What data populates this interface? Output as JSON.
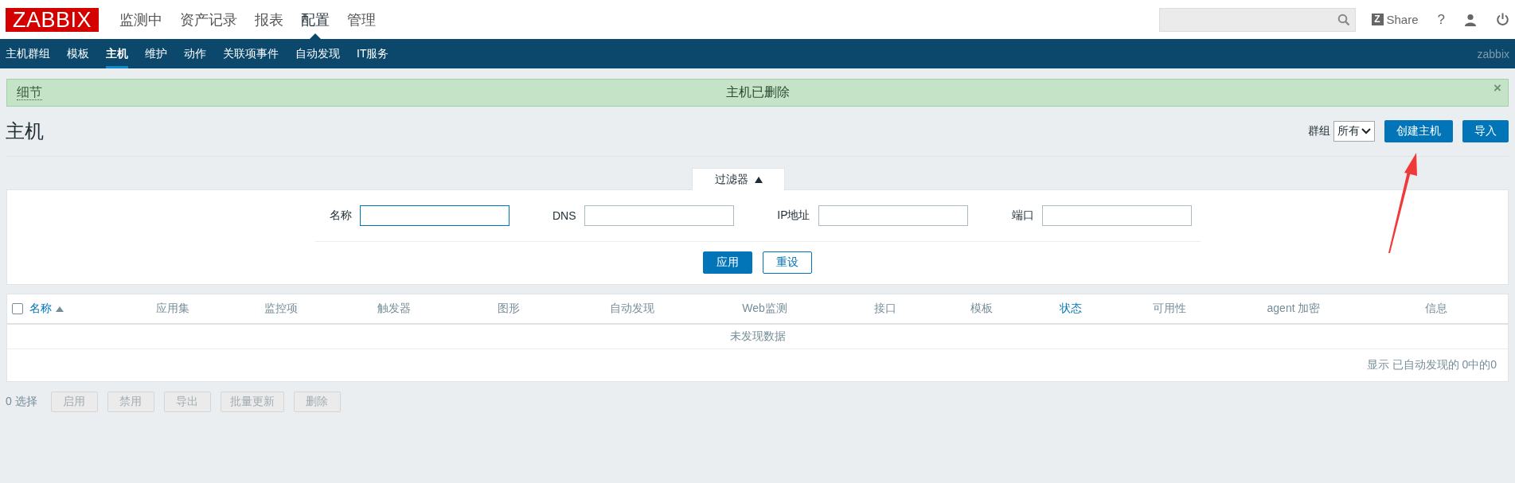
{
  "header": {
    "logo": "ZABBIX",
    "menu": [
      {
        "label": "监测中",
        "selected": false
      },
      {
        "label": "资产记录",
        "selected": false
      },
      {
        "label": "报表",
        "selected": false
      },
      {
        "label": "配置",
        "selected": true
      },
      {
        "label": "管理",
        "selected": false
      }
    ],
    "share": {
      "icon_text": "Z",
      "label": "Share"
    },
    "help": "?"
  },
  "subnav": {
    "items": [
      {
        "label": "主机群组",
        "selected": false
      },
      {
        "label": "模板",
        "selected": false
      },
      {
        "label": "主机",
        "selected": true
      },
      {
        "label": "维护",
        "selected": false
      },
      {
        "label": "动作",
        "selected": false
      },
      {
        "label": "关联项事件",
        "selected": false
      },
      {
        "label": "自动发现",
        "selected": false
      },
      {
        "label": "IT服务",
        "selected": false
      }
    ],
    "user": "zabbix"
  },
  "message": {
    "details_link": "细节",
    "text": "主机已删除",
    "close": "×"
  },
  "page": {
    "title": "主机",
    "group_label": "群组",
    "group_select": {
      "value": "所有"
    },
    "buttons": [
      "创建主机",
      "导入"
    ]
  },
  "filter": {
    "tab": {
      "label": "过滤器",
      "expanded": true
    },
    "fields": [
      {
        "label": "名称",
        "focused": true
      },
      {
        "label": "DNS",
        "focused": false
      },
      {
        "label": "IP地址",
        "focused": false
      },
      {
        "label": "端口",
        "focused": false
      }
    ],
    "buttons": [
      {
        "label": "应用",
        "kind": "primary"
      },
      {
        "label": "重设",
        "kind": "secondary"
      }
    ]
  },
  "table": {
    "select_all": {
      "checked": false
    },
    "columns": [
      {
        "label": "名称",
        "sortable": true,
        "sorted": true
      },
      {
        "label": "应用集",
        "sortable": false,
        "sorted": false
      },
      {
        "label": "监控项",
        "sortable": false,
        "sorted": false
      },
      {
        "label": "触发器",
        "sortable": false,
        "sorted": false
      },
      {
        "label": "图形",
        "sortable": false,
        "sorted": false
      },
      {
        "label": "自动发现",
        "sortable": false,
        "sorted": false
      },
      {
        "label": "Web监测",
        "sortable": false,
        "sorted": false
      },
      {
        "label": "接口",
        "sortable": false,
        "sorted": false
      },
      {
        "label": "模板",
        "sortable": false,
        "sorted": false
      },
      {
        "label": "状态",
        "sortable": true,
        "sorted": false
      },
      {
        "label": "可用性",
        "sortable": false,
        "sorted": false
      },
      {
        "label": "agent 加密",
        "sortable": false,
        "sorted": false
      },
      {
        "label": "信息",
        "sortable": false,
        "sorted": false
      }
    ],
    "empty_text": "未发现数据",
    "footer": "显示 已自动发现的 0中的0"
  },
  "actions": {
    "selected_count": "0 选择",
    "buttons": [
      {
        "label": "启用",
        "disabled": true
      },
      {
        "label": "禁用",
        "disabled": true
      },
      {
        "label": "导出",
        "disabled": true
      },
      {
        "label": "批量更新",
        "disabled": true
      },
      {
        "label": "删除",
        "disabled": true
      }
    ]
  }
}
